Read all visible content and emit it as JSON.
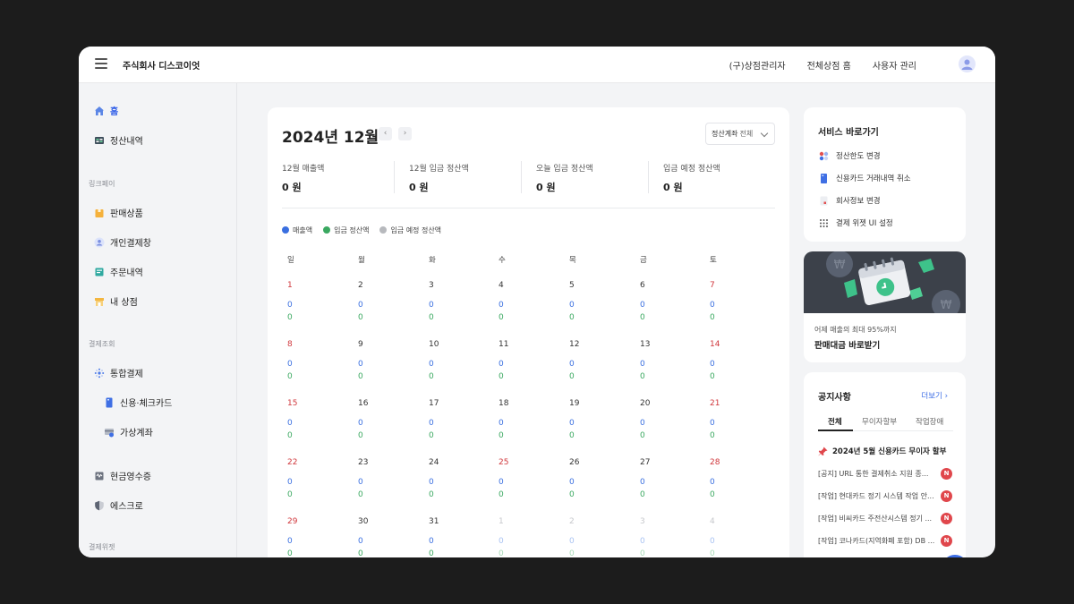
{
  "header": {
    "company": "주식회사 디스코이엇",
    "links": [
      "(구)상점관리자",
      "전체상점 홈",
      "사용자 관리"
    ]
  },
  "sidebar": {
    "home": "홈",
    "settlement": "정산내역",
    "group_linkpay": "링크페이",
    "products": "판매상품",
    "personal_payment": "개인결제창",
    "orders": "주문내역",
    "my_store": "내 상점",
    "group_payment": "결제조회",
    "integrated_payment": "통합결제",
    "card": "신용·체크카드",
    "virtual_account": "가상계좌",
    "cash_receipt": "현금영수증",
    "escrow": "에스크로",
    "group_widget": "결제위젯"
  },
  "calendar": {
    "title": "2024년 12월",
    "prev": "‹",
    "next": "›",
    "account_label": "정산계좌",
    "account_value": "전체",
    "stats": [
      {
        "label": "12월 매출액",
        "value": "0 원"
      },
      {
        "label": "12월 입금 정산액",
        "value": "0 원"
      },
      {
        "label": "오늘 입금 정산액",
        "value": "0 원"
      },
      {
        "label": "입금 예정 정산액",
        "value": "0 원"
      }
    ],
    "legend": [
      {
        "label": "매출액",
        "color": "#3a6fe0"
      },
      {
        "label": "입금 정산액",
        "color": "#3aa860"
      },
      {
        "label": "입금 예정 정산액",
        "color": "#b7b9bd"
      }
    ],
    "weekdays": [
      "일",
      "월",
      "화",
      "수",
      "목",
      "금",
      "토"
    ],
    "zero": "0",
    "weeks": [
      [
        "1",
        "2",
        "3",
        "4",
        "5",
        "6",
        "7"
      ],
      [
        "8",
        "9",
        "10",
        "11",
        "12",
        "13",
        "14"
      ],
      [
        "15",
        "16",
        "17",
        "18",
        "19",
        "20",
        "21"
      ],
      [
        "22",
        "23",
        "24",
        "25",
        "26",
        "27",
        "28"
      ],
      [
        "29",
        "30",
        "31",
        "1",
        "2",
        "3",
        "4"
      ]
    ]
  },
  "services": {
    "title": "서비스 바로가기",
    "items": [
      "정산한도 변경",
      "신용카드 거래내역 취소",
      "회사정보 변경",
      "결제 위젯 UI 설정"
    ]
  },
  "promo": {
    "sub": "어제 매출의 최대 95%까지",
    "main": "판매대금 바로받기",
    "coin": "₩"
  },
  "notices": {
    "title": "공지사항",
    "more": "더보기",
    "tabs": [
      "전체",
      "무이자할부",
      "작업장애"
    ],
    "pinned": "2024년 5월 신용카드 무이자 할부",
    "badge": "N",
    "items": [
      "[공지] URL 통한 결제취소 지원 종...",
      "[작업] 현대카드 정기 시스템 작업 안...",
      "[작업] 비씨카드 주전산시스템 정기 ...",
      "[작업] 코나카드(지역화폐 포함) DB ..."
    ]
  }
}
